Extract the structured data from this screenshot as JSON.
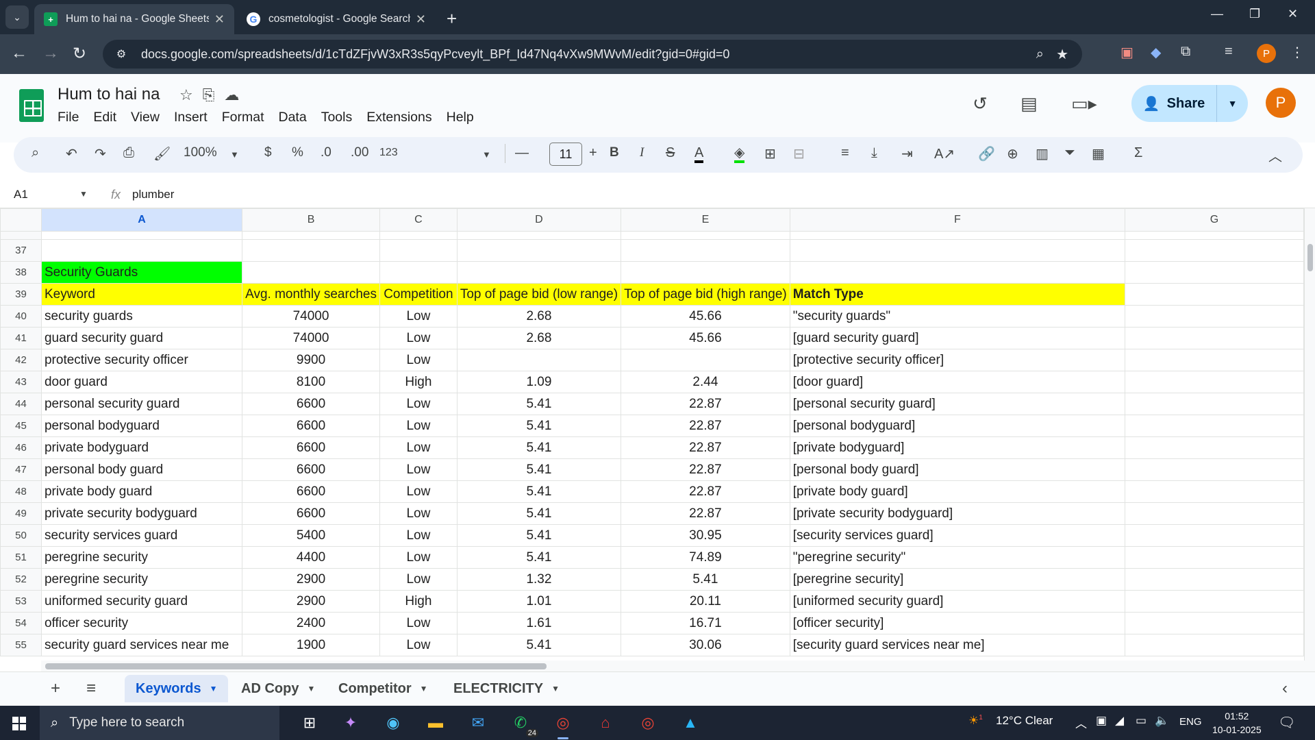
{
  "browser": {
    "tabs": [
      {
        "title": "Hum to hai na - Google Sheets",
        "active": true
      },
      {
        "title": "cosmetologist - Google Search",
        "active": false
      }
    ],
    "url": "docs.google.com/spreadsheets/d/1cTdZFjvW3xR3s5qyPcveylt_BPf_Id47Nq4vXw9MWvM/edit?gid=0#gid=0",
    "profile_initial": "P"
  },
  "sheets": {
    "doc_title": "Hum to hai na",
    "menu": [
      "File",
      "Edit",
      "View",
      "Insert",
      "Format",
      "Data",
      "Tools",
      "Extensions",
      "Help"
    ],
    "share_label": "Share",
    "avatar_initial": "P",
    "toolbar": {
      "zoom": "100%",
      "currency": "$",
      "percent": "%",
      "dec_decrease": ".0",
      "dec_increase": ".00",
      "format_123": "123",
      "font_size": "11",
      "bold": "B",
      "italic": "I"
    },
    "formula_bar": {
      "cell_ref": "A1",
      "value": "plumber"
    },
    "columns": [
      "A",
      "B",
      "C",
      "D",
      "E",
      "F",
      "G"
    ],
    "rows": [
      {
        "n": "37",
        "cells": [
          "",
          "",
          "",
          "",
          "",
          "",
          ""
        ]
      },
      {
        "n": "38",
        "cells": [
          "Security Guards",
          "",
          "",
          "",
          "",
          "",
          ""
        ]
      },
      {
        "n": "39",
        "cells": [
          "Keyword",
          "Avg. monthly searches",
          "Competition",
          "Top of page bid (low range)",
          "Top of page bid (high range)",
          "Match Type",
          ""
        ]
      },
      {
        "n": "40",
        "cells": [
          "security guards",
          "74000",
          "Low",
          "2.68",
          "45.66",
          "\"security guards\"",
          ""
        ]
      },
      {
        "n": "41",
        "cells": [
          "guard security guard",
          "74000",
          "Low",
          "2.68",
          "45.66",
          "[guard security guard]",
          ""
        ]
      },
      {
        "n": "42",
        "cells": [
          "protective security officer",
          "9900",
          "Low",
          "",
          "",
          "[protective security officer]",
          ""
        ]
      },
      {
        "n": "43",
        "cells": [
          "door guard",
          "8100",
          "High",
          "1.09",
          "2.44",
          "[door guard]",
          ""
        ]
      },
      {
        "n": "44",
        "cells": [
          "personal security guard",
          "6600",
          "Low",
          "5.41",
          "22.87",
          "[personal security guard]",
          ""
        ]
      },
      {
        "n": "45",
        "cells": [
          "personal bodyguard",
          "6600",
          "Low",
          "5.41",
          "22.87",
          "[personal bodyguard]",
          ""
        ]
      },
      {
        "n": "46",
        "cells": [
          "private bodyguard",
          "6600",
          "Low",
          "5.41",
          "22.87",
          "[private bodyguard]",
          ""
        ]
      },
      {
        "n": "47",
        "cells": [
          "personal body guard",
          "6600",
          "Low",
          "5.41",
          "22.87",
          "[personal body guard]",
          ""
        ]
      },
      {
        "n": "48",
        "cells": [
          "private body guard",
          "6600",
          "Low",
          "5.41",
          "22.87",
          "[private body guard]",
          ""
        ]
      },
      {
        "n": "49",
        "cells": [
          "private security bodyguard",
          "6600",
          "Low",
          "5.41",
          "22.87",
          "[private security bodyguard]",
          ""
        ]
      },
      {
        "n": "50",
        "cells": [
          "security services guard",
          "5400",
          "Low",
          "5.41",
          "30.95",
          "[security services guard]",
          ""
        ]
      },
      {
        "n": "51",
        "cells": [
          "peregrine security",
          "4400",
          "Low",
          "5.41",
          "74.89",
          "\"peregrine security\"",
          ""
        ]
      },
      {
        "n": "52",
        "cells": [
          "peregrine security",
          "2900",
          "Low",
          "1.32",
          "5.41",
          "[peregrine security]",
          ""
        ]
      },
      {
        "n": "53",
        "cells": [
          "uniformed security guard",
          "2900",
          "High",
          "1.01",
          "20.11",
          "[uniformed security guard]",
          ""
        ]
      },
      {
        "n": "54",
        "cells": [
          "officer security",
          "2400",
          "Low",
          "1.61",
          "16.71",
          "[officer security]",
          ""
        ]
      },
      {
        "n": "55",
        "cells": [
          "security guard services near me",
          "1900",
          "Low",
          "5.41",
          "30.06",
          "[security guard services near me]",
          ""
        ]
      }
    ],
    "sheet_tabs": [
      {
        "label": "Keywords",
        "active": true
      },
      {
        "label": "AD Copy",
        "active": false
      },
      {
        "label": "Competitor",
        "active": false
      },
      {
        "label": "ELECTRICITY",
        "active": false
      }
    ],
    "colors": {
      "section_fill": "#00ff00",
      "header_fill": "#ffff00",
      "selected_col": "#d3e3fd"
    }
  },
  "taskbar": {
    "search_placeholder": "Type here to search",
    "weather": "12°C  Clear",
    "language": "ENG",
    "time": "01:52",
    "date": "10-01-2025",
    "whatsapp_badge": "24",
    "weather_badge": "1"
  }
}
